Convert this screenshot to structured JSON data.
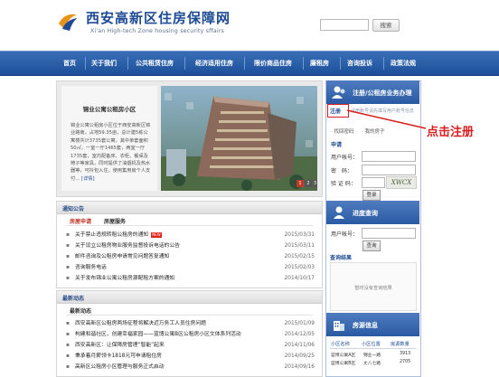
{
  "header": {
    "title": "西安高新区住房保障网",
    "subtitle": "Xi'an High-tech Zone housing security sffairs",
    "search_button": "搜索"
  },
  "nav": [
    {
      "label": "首页"
    },
    {
      "label": "关于我们"
    },
    {
      "label": "公共租赁住房"
    },
    {
      "label": "经济适用住房"
    },
    {
      "label": "限价商品住房"
    },
    {
      "label": "廉租房"
    },
    {
      "label": "咨询投诉"
    },
    {
      "label": "政策法规"
    }
  ],
  "banner": {
    "title": "锦业公寓公租房小区",
    "text": "锦业公寓公租房小区位于西安高新区锦业路南，占地59.35亩，总计建5栋公寓楼共计3735套公寓，其中单套面积50㎡，一室一厅1465套，两室一厅1735套，室内配备床、衣柜、餐桌及椅子等家具，同时提供了油烟机及热水器等，可拎包入住，使用集用房个人支付…",
    "more": "[详情]",
    "slides": [
      "1",
      "2",
      "3"
    ]
  },
  "notice": {
    "title": "通知公告",
    "tabs": [
      "房屋申请",
      "房屋服务"
    ],
    "items": [
      {
        "text": "关于禁止违规转租公租房的通知",
        "date": "2015/03/31",
        "hot": "NEW"
      },
      {
        "text": "关于设立公租房物业服务监督投诉电话的公告",
        "date": "2015/03/11"
      },
      {
        "text": "邮件咨询及公租房申请常见问题答复通知",
        "date": "2015/02/15"
      },
      {
        "text": "咨询服务电话",
        "date": "2015/02/03"
      },
      {
        "text": "关于发布锦业公寓公租房源配租方案的通知",
        "date": "2014/10/17"
      }
    ]
  },
  "news": {
    "title": "最新动态",
    "tab": "最新动态",
    "items": [
      {
        "text": "西安高新区公租房两场征程将解决近万务工人员住房问题",
        "date": "2015/01/09"
      },
      {
        "text": "构建和谐社区，创建幸福家园——蓝博公寓B区公租房小区文体系列活动",
        "date": "2014/12/05"
      },
      {
        "text": "西安高新区：让保障房管理“智能”起来",
        "date": "2014/11/06"
      },
      {
        "text": "秉承着月薪领卡1818元可申请租住房",
        "date": "2014/09/25"
      },
      {
        "text": "高新区公租房小区管理与服务正式启动",
        "date": "2014/09/16"
      }
    ]
  },
  "sidebar": {
    "register": {
      "title": "注册/公租房业务办理",
      "register_link": "注册",
      "register_hint": "注册账号请先填写用户账号信息",
      "forgot": "· 找回密码",
      "mine": "· 我的房子",
      "apply_title": "申请",
      "user_label": "用户帐号：",
      "pwd_label": "密　码：",
      "code_label": "验 证 码：",
      "captcha": "XWCX",
      "login_btn": "登录"
    },
    "progress": {
      "title": "进度查询",
      "user_label": "用户帐号：",
      "query_btn": "查询"
    },
    "result": {
      "title": "查询结果",
      "empty": "暂时没有查询结果"
    },
    "housing": {
      "title": "房源信息",
      "headers": [
        "小区名称",
        "小区位置",
        "房源数量"
      ],
      "rows": [
        {
          "name": "蓝博公寓A区",
          "loc": "锦业一路",
          "count": "3913"
        },
        {
          "name": "蓝博公寓B区",
          "loc": "丈八七路",
          "count": "2705"
        }
      ]
    }
  },
  "annotation": {
    "text": "点击注册"
  },
  "colors": {
    "nav": "#1c4f99",
    "accent_red": "#d81e1e",
    "panel_blue": "#2a5aa3"
  }
}
